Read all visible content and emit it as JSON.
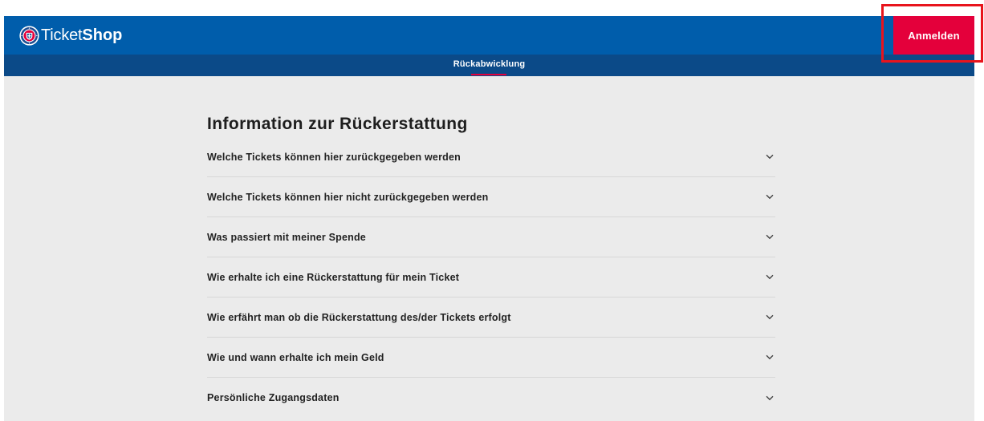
{
  "header": {
    "logo_icon": "club-emblem-icon",
    "logo_text_light": "Ticket",
    "logo_text_bold": "Shop",
    "login_label": "Anmelden"
  },
  "subnav": {
    "active_item": "Rückabwicklung"
  },
  "main": {
    "title": "Information zur Rückerstattung",
    "faq_items": [
      {
        "label": "Welche Tickets können hier zurückgegeben werden",
        "icon": "chevron-down-icon"
      },
      {
        "label": "Welche Tickets können hier nicht zurückgegeben werden",
        "icon": "chevron-down-icon"
      },
      {
        "label": "Was passiert mit meiner Spende",
        "icon": "chevron-down-icon"
      },
      {
        "label": "Wie erhalte ich eine Rückerstattung für mein Ticket",
        "icon": "chevron-down-icon"
      },
      {
        "label": "Wie erfährt man ob die Rückerstattung des/der Tickets erfolgt",
        "icon": "chevron-down-icon"
      },
      {
        "label": "Wie und wann erhalte ich mein Geld",
        "icon": "chevron-down-icon"
      },
      {
        "label": "Persönliche Zugangsdaten",
        "icon": "chevron-down-icon"
      }
    ]
  },
  "colors": {
    "header_blue": "#005dab",
    "subnav_blue": "#0b4a88",
    "accent_red": "#e4003b",
    "background_gray": "#ebebeb",
    "annotation_red": "#e8141c"
  }
}
